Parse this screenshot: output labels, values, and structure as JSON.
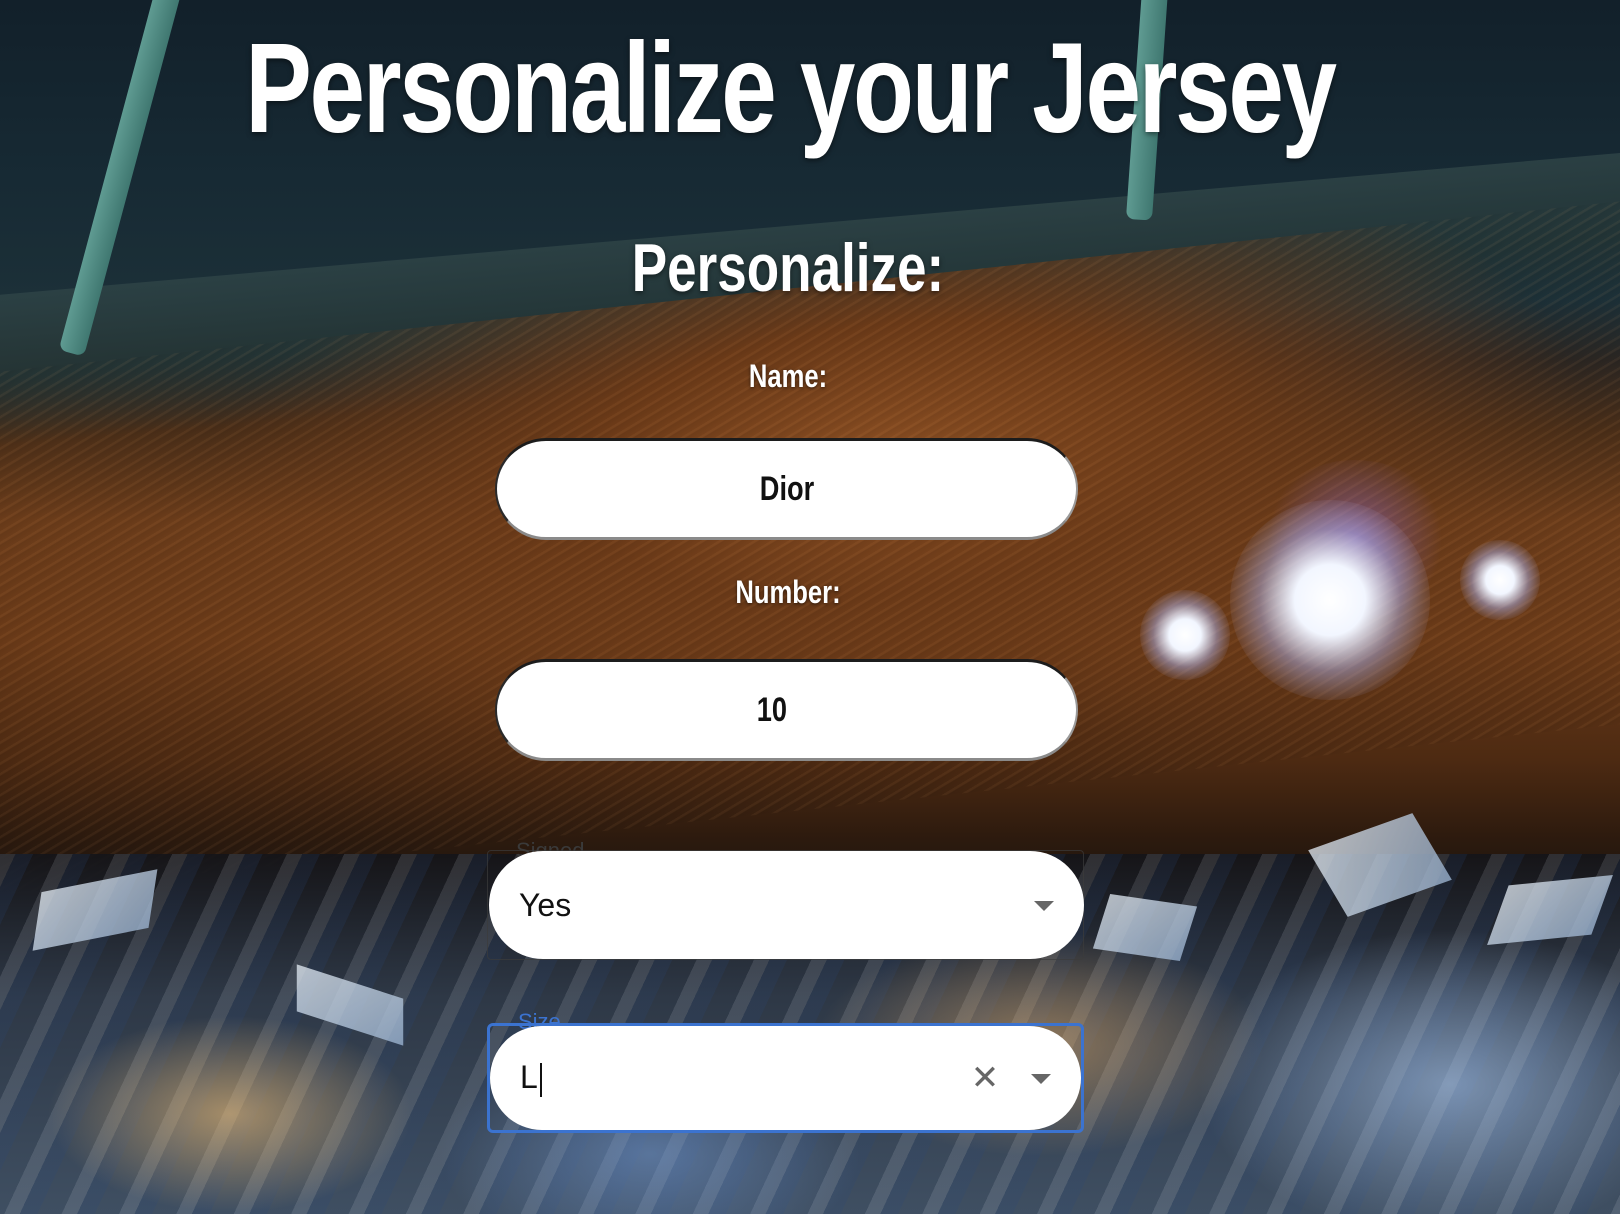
{
  "page": {
    "title": "Personalize your Jersey",
    "section_title": "Personalize:"
  },
  "form": {
    "name_label": "Name:",
    "name_value": "Dior",
    "number_label": "Number:",
    "number_value": "10",
    "signed": {
      "legend": "Signed",
      "value": "Yes"
    },
    "size": {
      "legend": "Size",
      "value": "L",
      "focused": true
    }
  },
  "icons": {
    "clear": "close-icon",
    "dropdown": "chevron-down-icon"
  },
  "colors": {
    "focus_accent": "#3b73d0",
    "title_text": "#ffffff",
    "input_bg": "#ffffff"
  }
}
